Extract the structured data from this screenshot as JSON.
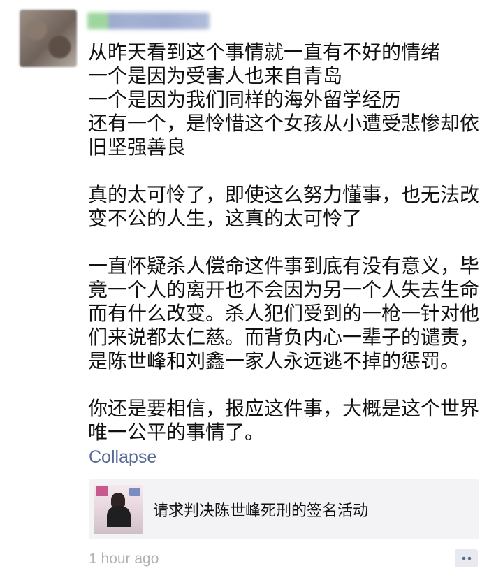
{
  "post": {
    "text": "从昨天看到这个事情就一直有不好的情绪\n一个是因为受害人也来自青岛\n一个是因为我们同样的海外留学经历\n还有一个，是怜惜这个女孩从小遭受悲惨却依旧坚强善良\n\n真的太可怜了，即使这么努力懂事，也无法改变不公的人生，这真的太可怜了\n\n一直怀疑杀人偿命这件事到底有没有意义，毕竟一个人的离开也不会因为另一个人失去生命而有什么改变。杀人犯们受到的一枪一针对他们来说都太仁慈。而背负内心一辈子的谴责，是陈世峰和刘鑫一家人永远逃不掉的惩罚。\n\n你还是要相信，报应这件事，大概是这个世界唯一公平的事情了。"
  },
  "actions": {
    "collapse_label": "Collapse"
  },
  "link_card": {
    "title": "请求判决陈世峰死刑的签名活动"
  },
  "meta": {
    "time": "1 hour ago"
  },
  "colors": {
    "link_blue": "#576b95",
    "time_gray": "#b2b2b2",
    "card_bg": "#f3f3f5"
  },
  "icons": {
    "comment": "comment-icon"
  }
}
